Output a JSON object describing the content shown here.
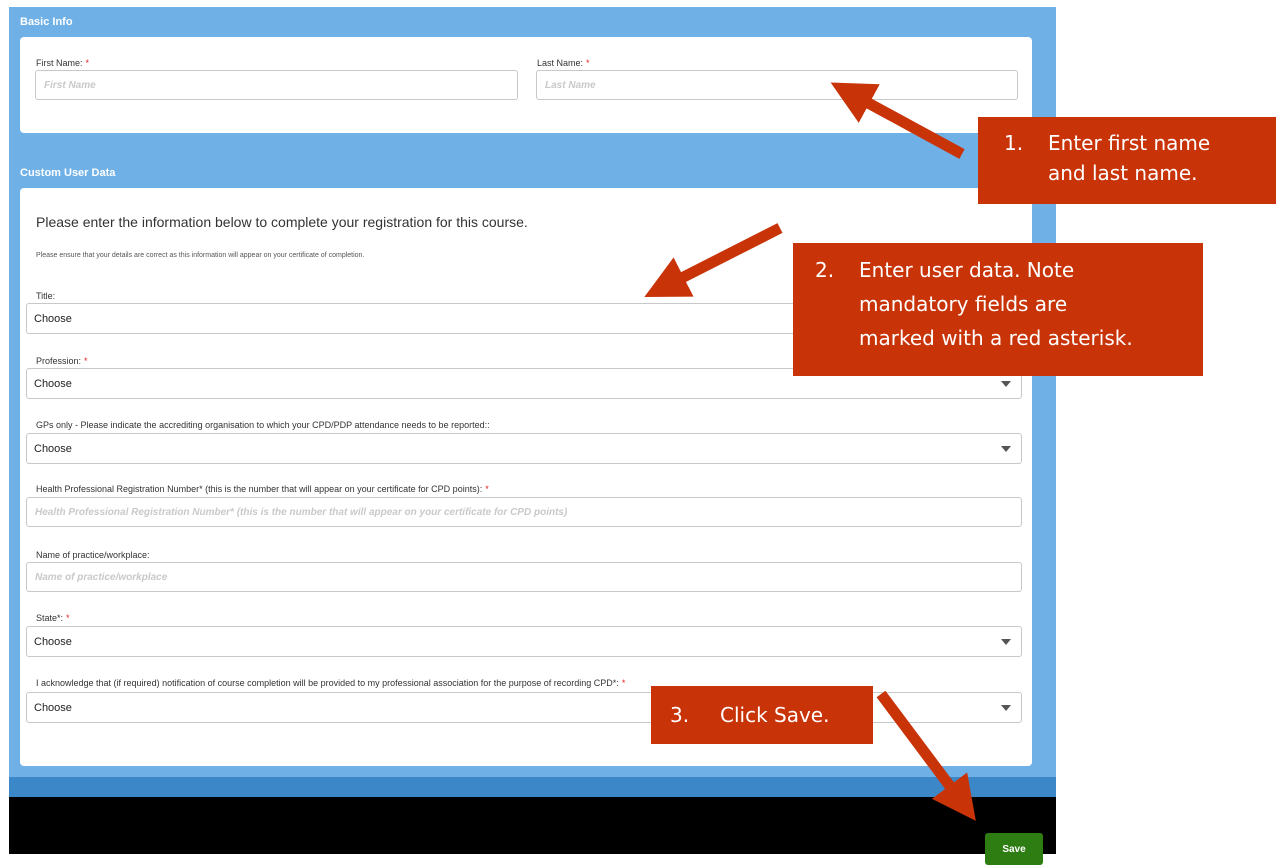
{
  "basic_info": {
    "header": "Basic Info",
    "first_name": {
      "label": "First Name:",
      "required": "*",
      "placeholder": "First Name"
    },
    "last_name": {
      "label": "Last Name:",
      "required": "*",
      "placeholder": "Last Name"
    }
  },
  "custom": {
    "header": "Custom User Data",
    "intro": "Please enter the information below to complete your registration for this course.",
    "note": "Please ensure that your details are correct as this information will appear on your certificate of completion.",
    "title_field": {
      "label": "Title:",
      "value": "Choose"
    },
    "profession": {
      "label": "Profession:",
      "required": "*",
      "value": "Choose"
    },
    "gps": {
      "label": "GPs only - Please indicate the accrediting organisation to which your CPD/PDP attendance needs to be reported::",
      "value": "Choose"
    },
    "hprn": {
      "label": "Health Professional Registration Number* (this is the number that will appear on your certificate for CPD points):",
      "required": "*",
      "placeholder": "Health Professional Registration Number* (this is the number that will appear on your certificate for CPD points)"
    },
    "practice": {
      "label": "Name of practice/workplace:",
      "placeholder": "Name of practice/workplace"
    },
    "state": {
      "label": "State*:",
      "required": "*",
      "value": "Choose"
    },
    "acknowledge": {
      "label": "I acknowledge that (if required) notification of course completion will be provided to my professional association for the purpose of recording CPD*:",
      "required": "*",
      "value": "Choose"
    }
  },
  "footer": {
    "save_label": "Save"
  },
  "callouts": {
    "c1": {
      "num": "1.",
      "line1": "Enter first name",
      "line2": "and last name."
    },
    "c2": {
      "num": "2.",
      "line1": "Enter user data. Note",
      "line2": "mandatory fields are",
      "line3": "marked with a red asterisk."
    },
    "c3": {
      "num": "3.",
      "line1": "Click Save."
    }
  },
  "colors": {
    "frame": "#6fb1e7",
    "callout": "#c93308",
    "save": "#2e7d12",
    "required": "#e02020"
  }
}
